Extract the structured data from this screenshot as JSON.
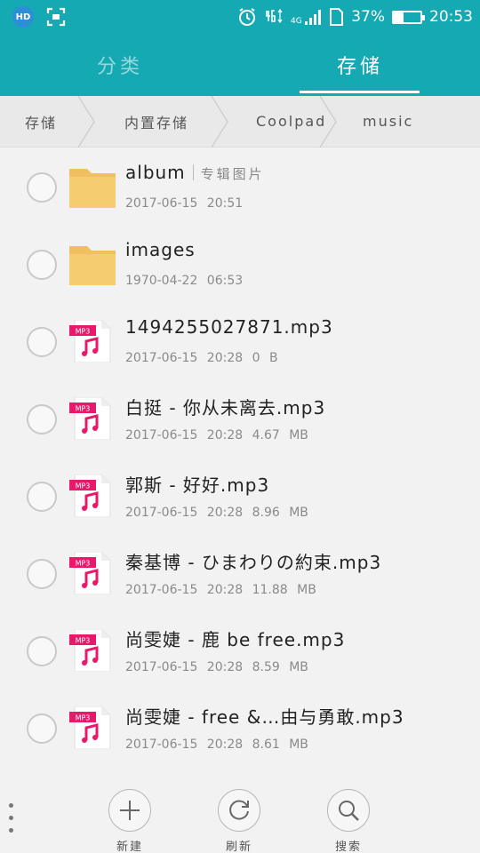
{
  "status_bar": {
    "left_icons": [
      "hd-icon",
      "screenshot-scan-icon"
    ],
    "hd_text": "HD",
    "right_icons": [
      "alarm-icon",
      "network-4g-icon",
      "signal-icon",
      "sim-icon"
    ],
    "battery_percent_text": "37%",
    "battery_level": 0.37,
    "time": "20:53",
    "colors": {
      "bar": "#14a9b3",
      "text": "#ffffff"
    }
  },
  "tabs": [
    {
      "label": "分类",
      "active": false
    },
    {
      "label": "存储",
      "active": true
    }
  ],
  "breadcrumb": [
    "存储",
    "内置存储",
    "Coolpad",
    "music"
  ],
  "files": [
    {
      "type": "folder",
      "name": "album",
      "tag": "专辑图片",
      "meta": "2017-06-15 20:51"
    },
    {
      "type": "folder",
      "name": "images",
      "tag": "",
      "meta": "1970-04-22 06:53"
    },
    {
      "type": "mp3",
      "name": "1494255027871.mp3",
      "meta": "2017-06-15 20:28 0 B"
    },
    {
      "type": "mp3",
      "name": "白挺 - 你从未离去.mp3",
      "meta": "2017-06-15 20:28 4.67 MB"
    },
    {
      "type": "mp3",
      "name": "郭斯 - 好好.mp3",
      "meta": "2017-06-15 20:28 8.96 MB"
    },
    {
      "type": "mp3",
      "name": "秦基博 - ひまわりの約束.mp3",
      "meta": "2017-06-15 20:28 11.88 MB"
    },
    {
      "type": "mp3",
      "name": "尚雯婕 - 鹿 be free.mp3",
      "meta": "2017-06-15 20:28 8.59 MB"
    },
    {
      "type": "mp3",
      "name": "尚雯婕 - free &…由与勇敢.mp3",
      "meta": "2017-06-15 20:28 8.61 MB"
    }
  ],
  "mp3_badge": "MP3",
  "bottom_actions": [
    {
      "label": "新建",
      "icon": "plus-icon"
    },
    {
      "label": "刷新",
      "icon": "refresh-icon"
    },
    {
      "label": "搜索",
      "icon": "search-icon"
    }
  ],
  "colors": {
    "accent": "#14a9b3",
    "folder": "#f0c060",
    "mp3": "#e8196b"
  }
}
